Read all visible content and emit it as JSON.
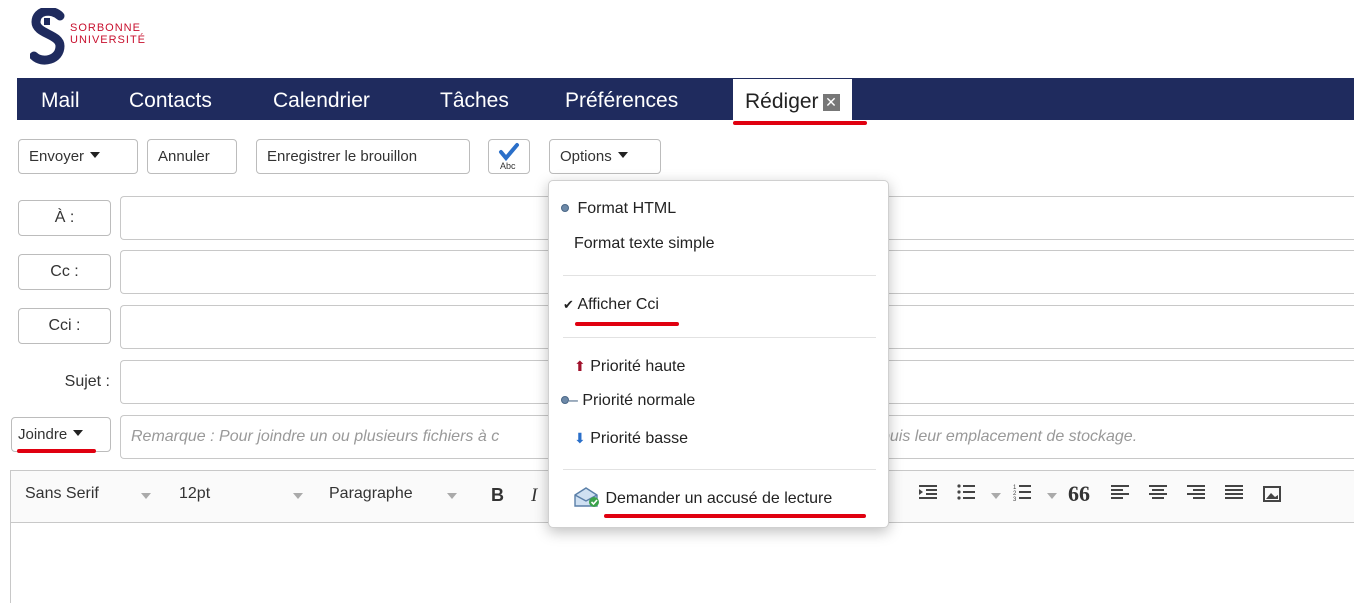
{
  "brand": {
    "name": "SORBONNE",
    "sub": "UNIVERSITÉ",
    "accent": "#c8102e"
  },
  "nav": {
    "bg": "#1f2b5e",
    "items": [
      "Mail",
      "Contacts",
      "Calendrier",
      "Tâches",
      "Préférences"
    ],
    "active": "Rédiger",
    "close_symbol": "✕"
  },
  "toolbar": {
    "send": "Envoyer",
    "cancel": "Annuler",
    "save_draft": "Enregistrer le brouillon",
    "spellcheck": "Abc",
    "options": "Options"
  },
  "fields": {
    "to": "À :",
    "cc": "Cc :",
    "bcc": "Cci :",
    "subject": "Sujet :",
    "attach": "Joindre",
    "attach_note": "Remarque : Pour joindre un ou plusieurs fichiers à c",
    "attach_note_tail": "puis leur emplacement de stockage."
  },
  "editor": {
    "font": "Sans Serif",
    "size": "12pt",
    "block": "Paragraphe",
    "bold": "B",
    "italic": "I",
    "quote": "66"
  },
  "options_menu": {
    "format_html": "Format HTML",
    "format_text": "Format texte simple",
    "show_bcc": "Afficher Cci",
    "priority_high": "Priorité haute",
    "priority_normal": "Priorité normale",
    "priority_low": "Priorité basse",
    "read_receipt": "Demander un accusé de lecture"
  },
  "icons": {
    "check": "✔",
    "arrow_up": "⬆",
    "arrow_down": "⬇",
    "dash": "–"
  }
}
